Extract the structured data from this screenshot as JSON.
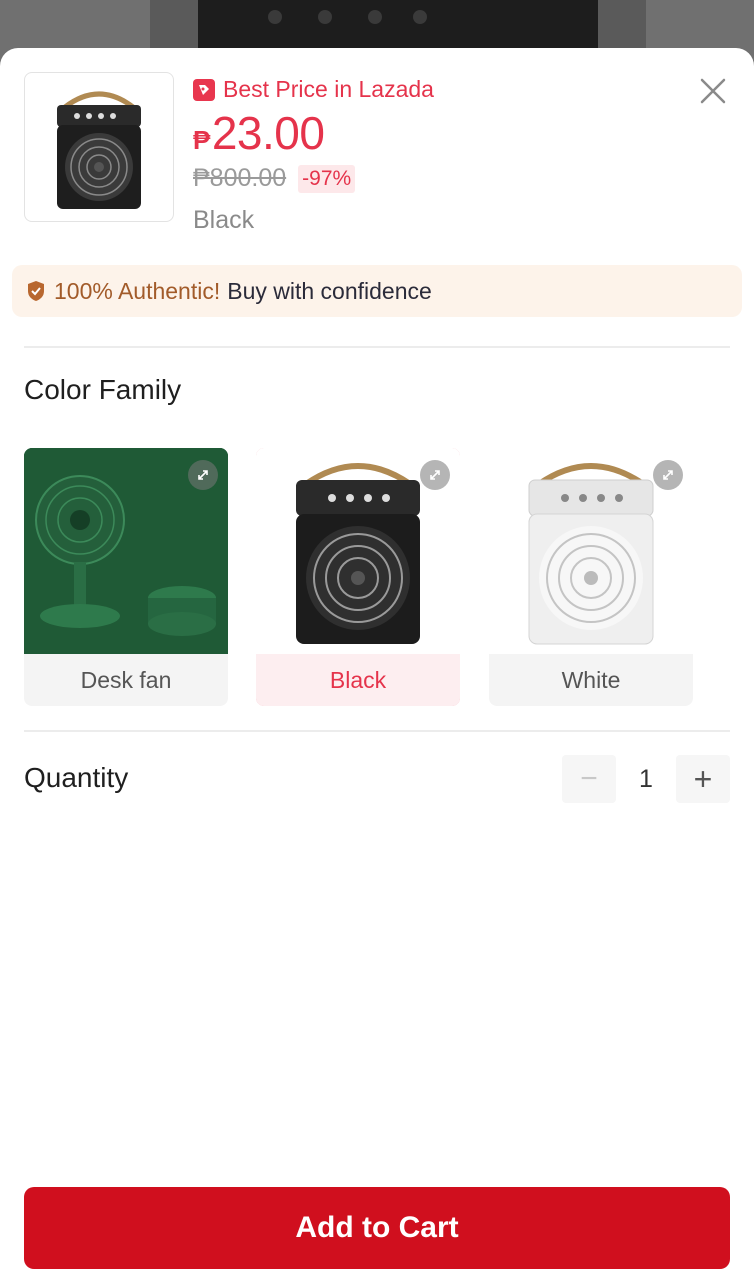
{
  "product": {
    "badge": "Best Price in Lazada",
    "currency": "₱",
    "price": "23.00",
    "original_price": "₱800.00",
    "discount": "-97%",
    "selected_variant": "Black"
  },
  "authentic": {
    "highlight": "100% Authentic!",
    "text": "Buy with confidence"
  },
  "color_family": {
    "title": "Color Family",
    "options": [
      {
        "label": "Desk fan",
        "selected": false
      },
      {
        "label": "Black",
        "selected": true
      },
      {
        "label": "White",
        "selected": false
      }
    ]
  },
  "quantity": {
    "label": "Quantity",
    "value": "1",
    "minus": "−",
    "plus": "+"
  },
  "actions": {
    "add_to_cart": "Add to Cart"
  },
  "colors": {
    "accent": "#e5334b",
    "cart_button": "#d00f1e",
    "authentic_bg": "#fdf3ea"
  }
}
